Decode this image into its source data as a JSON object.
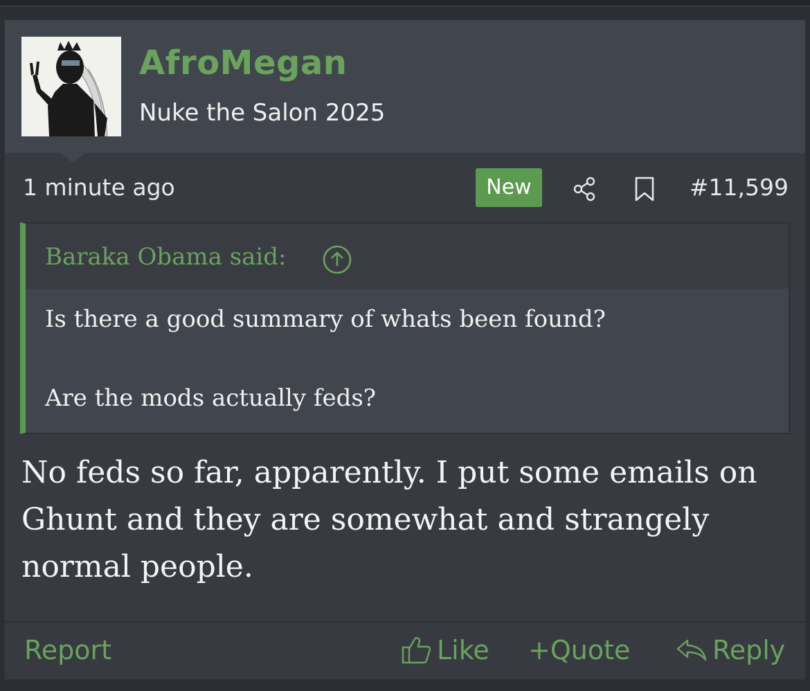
{
  "post": {
    "username": "AfroMegan",
    "user_title": "Nuke the Salon 2025",
    "time": "1 minute ago",
    "badge": "New",
    "post_number": "#11,599",
    "quote": {
      "author": "Baraka Obama said:",
      "lines": [
        "Is there a good summary of whats been found?",
        "Are the mods actually feds?"
      ]
    },
    "message_lines": [
      "No feds so far, apparently. I put some emails on",
      "Ghunt and they are somewhat and strangely",
      "normal people."
    ],
    "actions": {
      "report": "Report",
      "like": "Like",
      "quote": "Quote",
      "quote_prefix": "+",
      "reply": "Reply"
    }
  },
  "colors": {
    "accent": "#6aa35c",
    "badge": "#5c9b4f",
    "background": "#373a41",
    "panel": "#41454d"
  },
  "icons": [
    "share-icon",
    "bookmark-icon",
    "arrow-up-circle-icon",
    "thumbs-up-icon",
    "reply-arrow-icon"
  ]
}
